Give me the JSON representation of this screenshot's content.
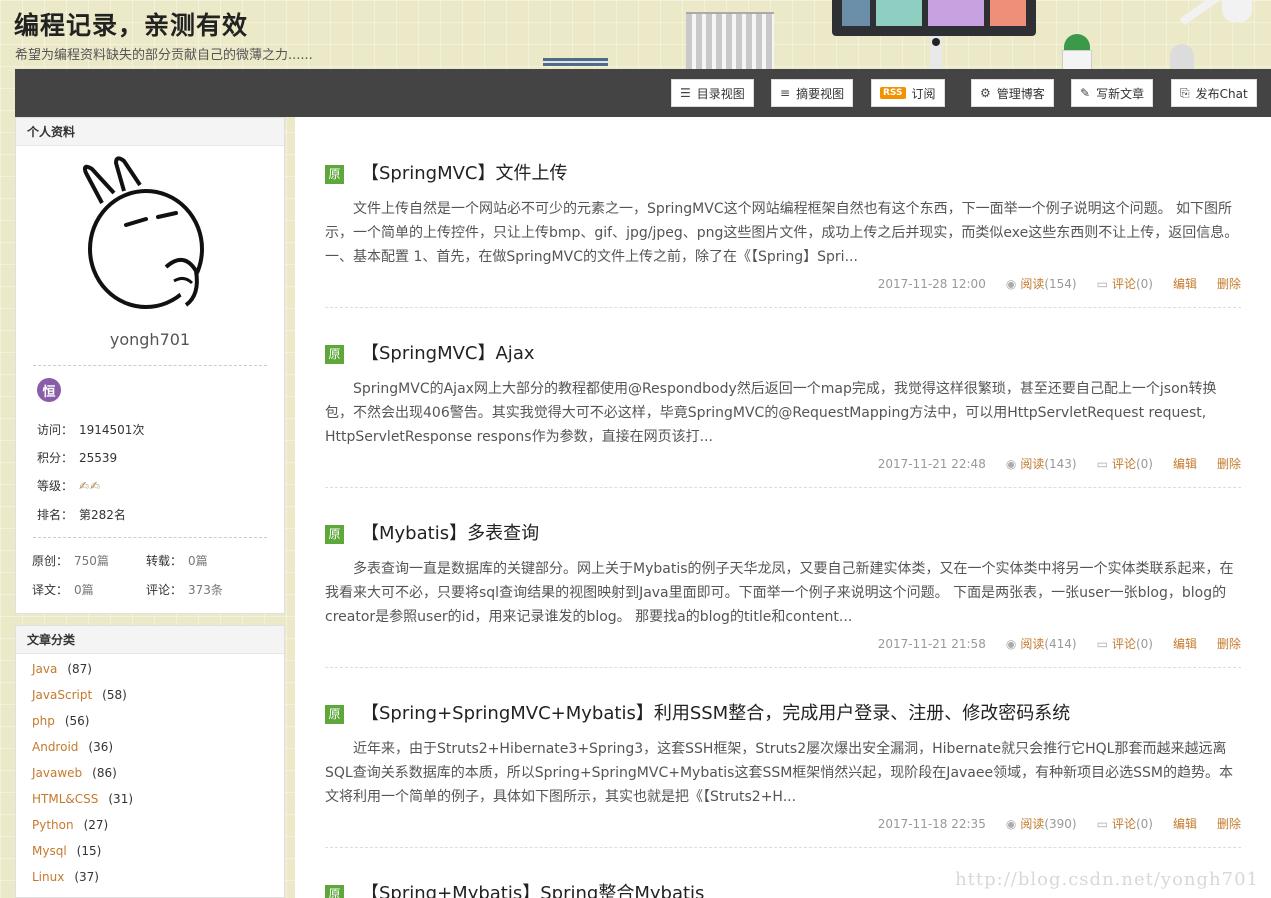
{
  "header": {
    "title": "编程记录，亲测有效",
    "subtitle": "希望为编程资料缺失的部分贡献自己的微薄之力......"
  },
  "toolbar": {
    "buttons": [
      {
        "label": "目录视图",
        "icon": "list-icon"
      },
      {
        "label": "摘要视图",
        "icon": "summary-icon"
      },
      {
        "label": "订阅",
        "icon": "rss-icon",
        "icon_text": "RSS"
      },
      {
        "label": "管理博客",
        "icon": "gear-icon"
      },
      {
        "label": "写新文章",
        "icon": "pencil-icon"
      },
      {
        "label": "发布Chat",
        "icon": "chat-icon"
      }
    ]
  },
  "profile": {
    "heading": "个人资料",
    "username": "yongh701",
    "medal_text": "恒",
    "stats": [
      {
        "label": "访问：",
        "value": "1914501次"
      },
      {
        "label": "积分：",
        "value": "25539"
      },
      {
        "label": "等级：",
        "value": "✍✍"
      },
      {
        "label": "排名：",
        "value": "第282名"
      }
    ],
    "counts": [
      {
        "label": "原创：",
        "value": "750篇"
      },
      {
        "label": "转载：",
        "value": "0篇"
      },
      {
        "label": "译文：",
        "value": "0篇"
      },
      {
        "label": "评论：",
        "value": "373条"
      }
    ]
  },
  "categories": {
    "heading": "文章分类",
    "items": [
      {
        "name": "Java",
        "count": "(87)"
      },
      {
        "name": "JavaScript",
        "count": "(58)"
      },
      {
        "name": "php",
        "count": "(56)"
      },
      {
        "name": "Android",
        "count": "(36)"
      },
      {
        "name": "Javaweb",
        "count": "(86)"
      },
      {
        "name": "HTML&CSS",
        "count": "(31)"
      },
      {
        "name": "Python",
        "count": "(27)"
      },
      {
        "name": "Mysql",
        "count": "(15)"
      },
      {
        "name": "Linux",
        "count": "(37)"
      }
    ]
  },
  "posts": [
    {
      "badge": "原",
      "title": "【SpringMVC】文件上传",
      "summary": "文件上传自然是一个网站必不可少的元素之一，SpringMVC这个网站编程框架自然也有这个东西，下一面举一个例子说明这个问题。 如下图所示，一个简单的上传控件，只让上传bmp、gif、jpg/jpeg、png这些图片文件，成功上传之后并现实，而类似exe这些东西则不让上传，返回信息。 一、基本配置 1、首先，在做SpringMVC的文件上传之前，除了在《【Spring】Spri...",
      "date": "2017-11-28 12:00",
      "read_label": "阅读",
      "read_count": "(154)",
      "comment_label": "评论",
      "comment_count": "(0)",
      "edit_label": "编辑",
      "delete_label": "删除"
    },
    {
      "badge": "原",
      "title": "【SpringMVC】Ajax",
      "summary": "SpringMVC的Ajax网上大部分的教程都使用@Respondbody然后返回一个map完成，我觉得这样很繁琐，甚至还要自己配上一个json转换包，不然会出现406警告。其实我觉得大可不必这样，毕竟SpringMVC的@RequestMapping方法中，可以用HttpServletRequest request, HttpServletResponse respons作为参数，直接在网页该打...",
      "date": "2017-11-21 22:48",
      "read_label": "阅读",
      "read_count": "(143)",
      "comment_label": "评论",
      "comment_count": "(0)",
      "edit_label": "编辑",
      "delete_label": "删除"
    },
    {
      "badge": "原",
      "title": "【Mybatis】多表查询",
      "summary": "多表查询一直是数据库的关键部分。网上关于Mybatis的例子天华龙凤，又要自己新建实体类，又在一个实体类中将另一个实体类联系起来，在我看来大可不必，只要将sql查询结果的视图映射到Java里面即可。下面举一个例子来说明这个问题。 下面是两张表，一张user一张blog，blog的creator是参照user的id，用来记录谁发的blog。 那要找a的blog的title和content...",
      "date": "2017-11-21 21:58",
      "read_label": "阅读",
      "read_count": "(414)",
      "comment_label": "评论",
      "comment_count": "(0)",
      "edit_label": "编辑",
      "delete_label": "删除"
    },
    {
      "badge": "原",
      "title": "【Spring+SpringMVC+Mybatis】利用SSM整合，完成用户登录、注册、修改密码系统",
      "summary": "近年来，由于Struts2+Hibernate3+Spring3，这套SSH框架，Struts2屡次爆出安全漏洞，Hibernate就只会推行它HQL那套而越来越远离SQL查询关系数据库的本质，所以Spring+SpringMVC+Mybatis这套SSM框架悄然兴起，现阶段在Javaee领域，有种新项目必选SSM的趋势。本文将利用一个简单的例子，具体如下图所示，其实也就是把《【Struts2+H...",
      "date": "2017-11-18 22:35",
      "read_label": "阅读",
      "read_count": "(390)",
      "comment_label": "评论",
      "comment_count": "(0)",
      "edit_label": "编辑",
      "delete_label": "删除"
    },
    {
      "badge": "原",
      "title": "【Spring+Mybatis】Spring整合Mybatis"
    }
  ],
  "watermark": "http://blog.csdn.net/yongh701",
  "colors": {
    "toolbar_bg": "#444444",
    "badge_green": "#5ea83b",
    "link_orange": "#c47a2c",
    "rss_orange": "#f29200",
    "medal_purple": "#8a5da8"
  }
}
